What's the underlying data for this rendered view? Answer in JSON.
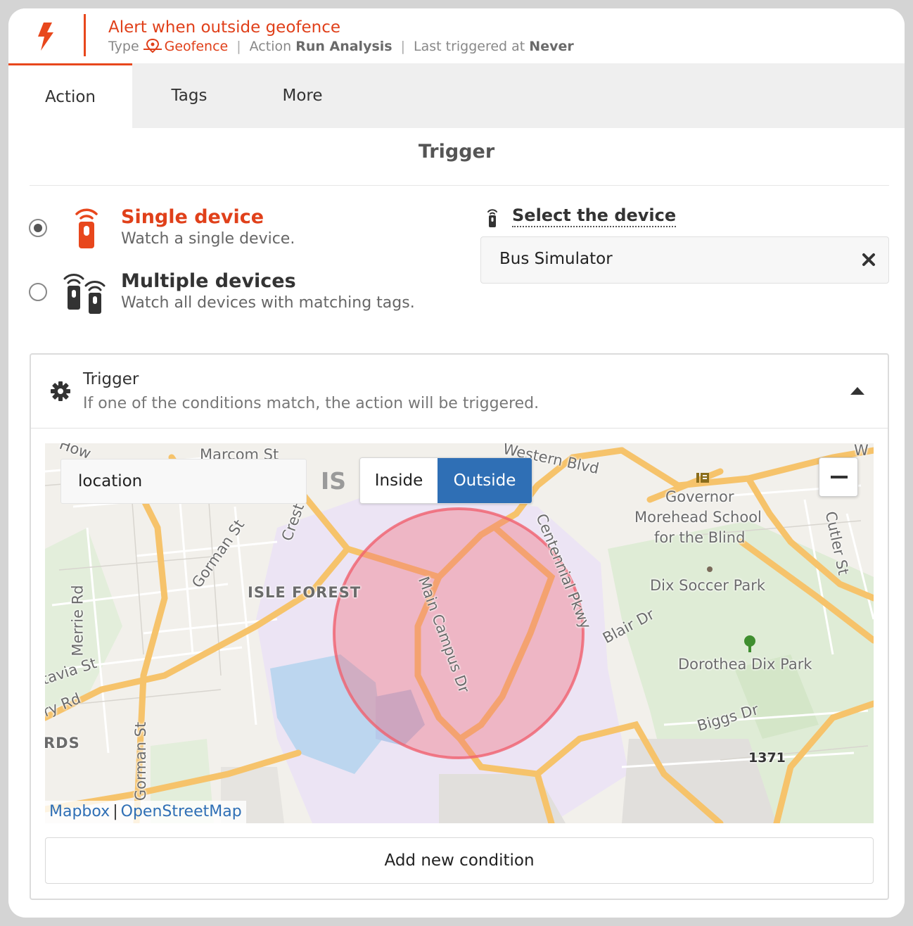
{
  "header": {
    "title": "Alert when outside geofence",
    "type_label": "Type",
    "type_value": "Geofence",
    "action_label": "Action",
    "action_value": "Run Analysis",
    "last_label": "Last triggered at",
    "last_value": "Never",
    "separator": "|",
    "accent": "#e8471c"
  },
  "tabs": [
    {
      "label": "Action",
      "active": true
    },
    {
      "label": "Tags",
      "active": false
    },
    {
      "label": "More",
      "active": false
    }
  ],
  "section_title": "Trigger",
  "device_options": {
    "single": {
      "title": "Single device",
      "subtitle": "Watch a single device.",
      "selected": true,
      "icon": "remote-device-icon"
    },
    "multiple": {
      "title": "Multiple devices",
      "subtitle": "Watch all devices with matching tags.",
      "selected": false,
      "icon": "multiple-devices-icon"
    }
  },
  "device_select": {
    "label": "Select the device",
    "value": "Bus Simulator",
    "clear_icon": "close-icon"
  },
  "trigger_panel": {
    "title": "Trigger",
    "subtitle": "If one of the conditions match, the action will be triggered.",
    "icon": "gear-icon",
    "collapse_icon": "caret-up-icon"
  },
  "condition": {
    "field": "location",
    "operator": "IS",
    "options": [
      "Inside",
      "Outside"
    ],
    "selected": "Outside",
    "selected_color": "#2f6fb5"
  },
  "map": {
    "labels": {
      "western_blvd": "Western Blvd",
      "marcom_st": "Marcom St",
      "crest": "Crest",
      "gorman_st_top": "Gorman St",
      "gorman_st_bottom": "Gorman St",
      "merrie_rd": "Merrie Rd",
      "tavia_st": "tavia St",
      "ry_rd": "ry Rd",
      "rds": "RDS",
      "isle_forest": "ISLE FOREST",
      "main_campus_dr": "Main Campus Dr",
      "centennial_pkwy": "Centennial Pkwy",
      "governor": "Governor",
      "morehead_school": "Morehead School",
      "for_the_blind": "for the Blind",
      "dix_soccer_park": "Dix Soccer Park",
      "blair_dr": "Blair Dr",
      "dorothea_dix_park": "Dorothea Dix Park",
      "biggs_dr": "Biggs Dr",
      "cutler_st": "Cutler St",
      "number_1371": "1371",
      "how": "How",
      "w": "W"
    },
    "geofence_color": "#f26b7a",
    "zoom_out_icon": "minus-icon",
    "attribution": [
      "Mapbox",
      "OpenStreetMap"
    ],
    "attribution_sep": "|"
  },
  "add_condition_label": "Add new condition"
}
